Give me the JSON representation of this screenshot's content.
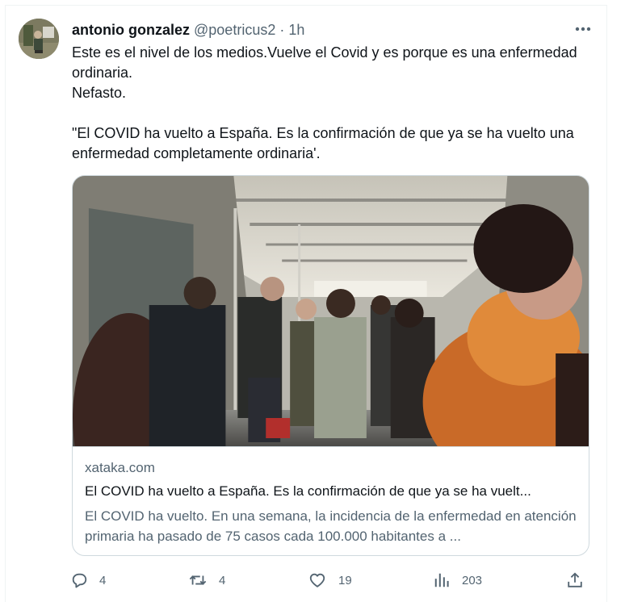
{
  "author": {
    "name": "antonio gonzalez",
    "handle": "@poetricus2",
    "separator": "·",
    "time": "1h",
    "avatar_icon": "user-avatar-photo"
  },
  "tweet": {
    "line1": "Este es el nivel de los medios.Vuelve el Covid y es porque es una enfermedad ordinaria.",
    "line2": "Nefasto.",
    "quote": "\"El COVID ha vuelto a España. Es la confirmación de que ya se ha vuelto una enfermedad completamente ordinaria'."
  },
  "card": {
    "image_icon": "subway-passengers-photo",
    "domain": "xataka.com",
    "title": "El COVID ha vuelto a España. Es la confirmación de que ya se ha vuelt...",
    "description": "El COVID ha vuelto. En una semana, la incidencia de la enfermedad en atención primaria ha pasado de 75 casos cada 100.000 habitantes a ..."
  },
  "actions": {
    "reply_count": "4",
    "retweet_count": "4",
    "like_count": "19",
    "views_count": "203",
    "reply_icon": "reply-icon",
    "retweet_icon": "retweet-icon",
    "like_icon": "heart-icon",
    "views_icon": "analytics-icon",
    "share_icon": "share-icon",
    "more_icon": "more-icon"
  },
  "colors": {
    "text": "#0f1419",
    "secondary": "#536471",
    "border": "#cfd9de"
  }
}
